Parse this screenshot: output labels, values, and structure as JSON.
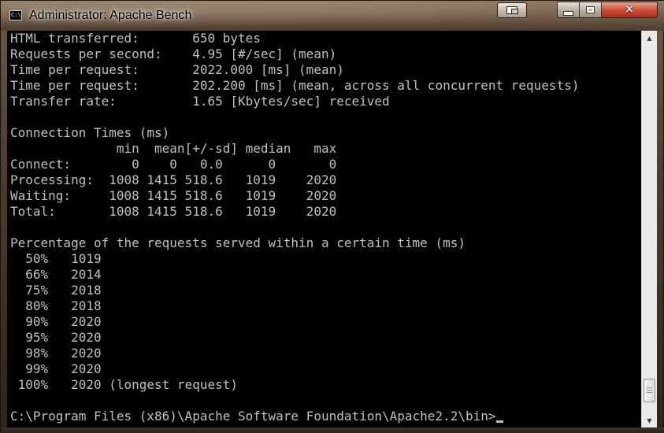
{
  "window": {
    "title": "Administrator: Apache Bench",
    "icon_text": "C:\\"
  },
  "caption_buttons": {
    "close_glyph": "✕"
  },
  "console": {
    "lines": [
      "HTML transferred:       650 bytes",
      "Requests per second:    4.95 [#/sec] (mean)",
      "Time per request:       2022.000 [ms] (mean)",
      "Time per request:       202.200 [ms] (mean, across all concurrent requests)",
      "Transfer rate:          1.65 [Kbytes/sec] received",
      "",
      "Connection Times (ms)",
      "              min  mean[+/-sd] median   max",
      "Connect:        0    0   0.0      0       0",
      "Processing:  1008 1415 518.6   1019    2020",
      "Waiting:     1008 1415 518.6   1019    2020",
      "Total:       1008 1415 518.6   1019    2020",
      "",
      "Percentage of the requests served within a certain time (ms)",
      "  50%   1019",
      "  66%   2014",
      "  75%   2018",
      "  80%   2018",
      "  90%   2020",
      "  95%   2020",
      "  98%   2020",
      "  99%   2020",
      " 100%   2020 (longest request)"
    ],
    "prompt": "C:\\Program Files (x86)\\Apache Software Foundation\\Apache2.2\\bin>"
  },
  "scrollbar": {
    "up_arrow": "▲",
    "down_arrow": "▼"
  },
  "colors": {
    "console_bg": "#000000",
    "console_text": "#c0c0c0",
    "close_button": "#c9503a"
  }
}
